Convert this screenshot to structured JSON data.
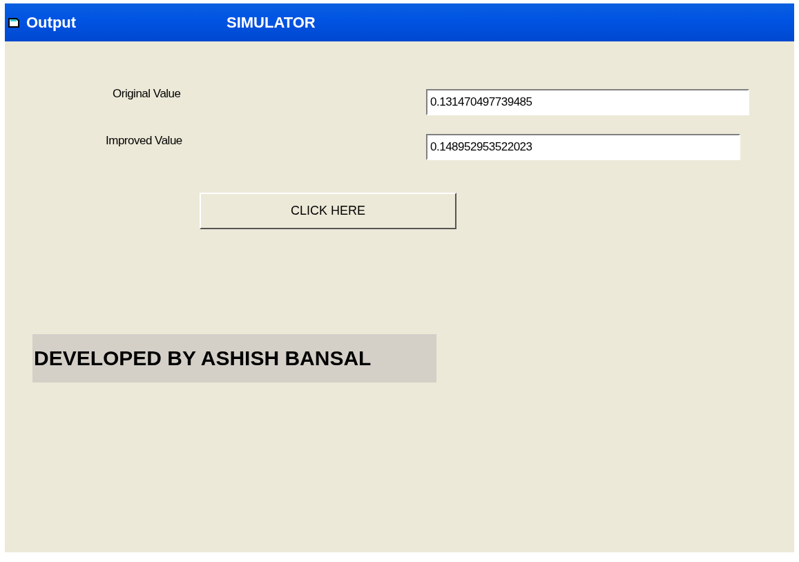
{
  "window": {
    "title": "Output",
    "caption": "SIMULATOR"
  },
  "fields": [
    {
      "label": "Original Value",
      "value": "0.131470497739485"
    },
    {
      "label": "Improved Value",
      "value": "0.148952953522023"
    }
  ],
  "button": {
    "label": "CLICK HERE"
  },
  "credit": "DEVELOPED BY ASHISH BANSAL"
}
